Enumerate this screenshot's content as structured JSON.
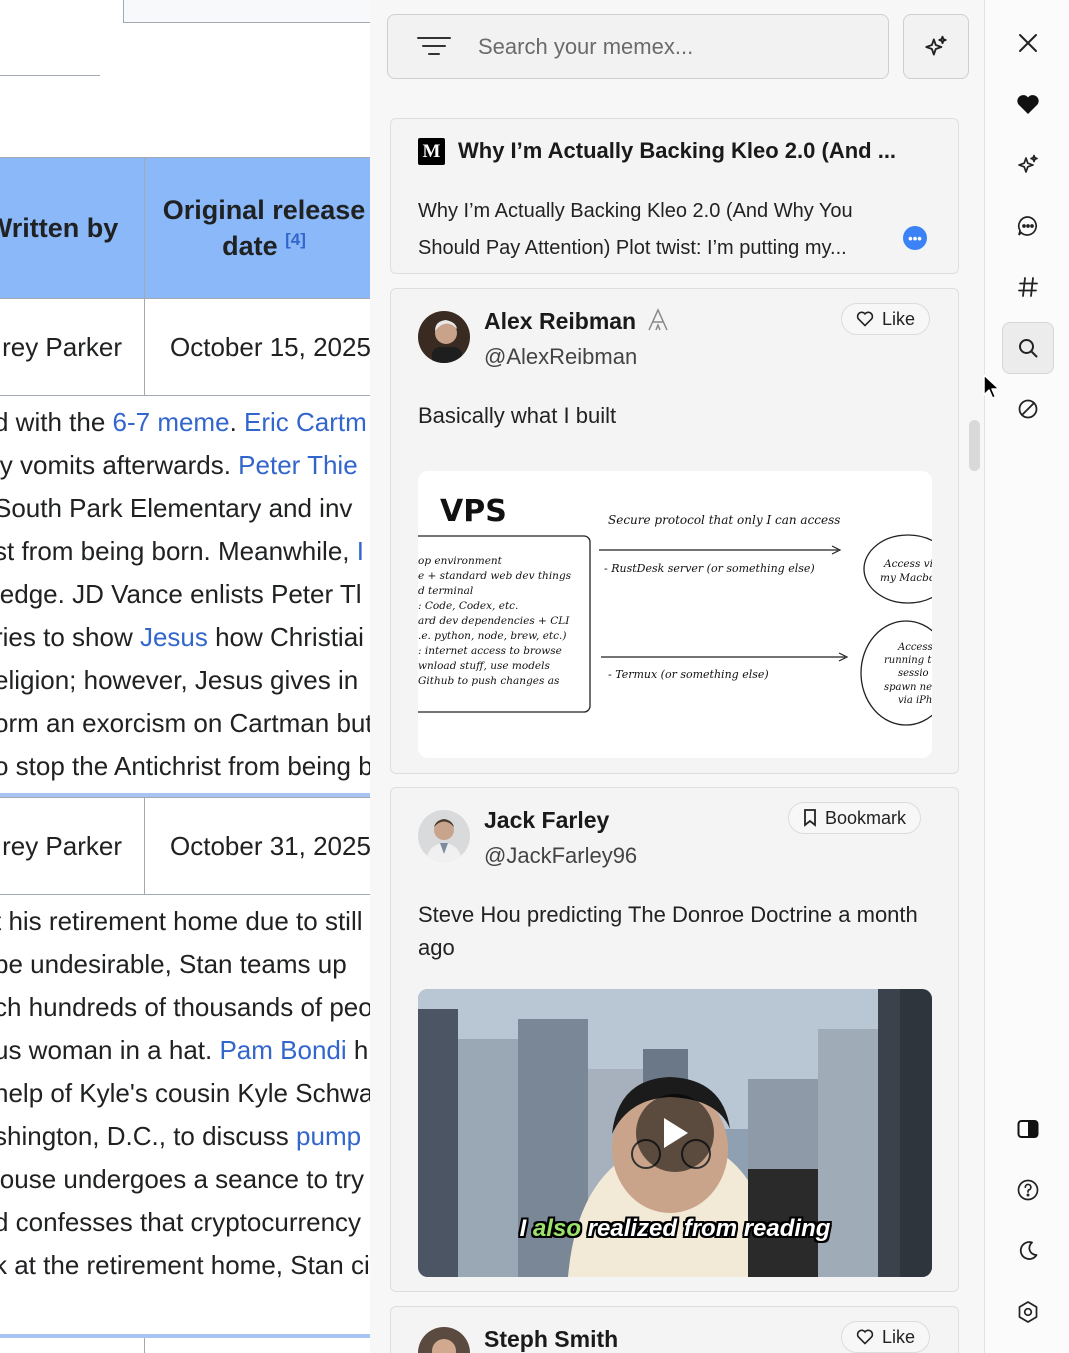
{
  "wiki": {
    "table_headers": [
      "Written by",
      "Original release date"
    ],
    "header_ref": "[4]",
    "rows": [
      {
        "written_by": "rey Parker",
        "release_date": "October 15, 2025"
      },
      {
        "written_by": "rey Parker",
        "release_date": "October 31, 2025"
      }
    ],
    "para1": [
      {
        "pre": "d with the ",
        "link": "6-7 meme",
        "mid": ". ",
        "link2": "Eric Cartm",
        "post": ""
      },
      {
        "pre": "ly vomits afterwards. ",
        "link": "Peter Thie",
        "mid": "",
        "link2": "",
        "post": ""
      },
      {
        "pre": " South Park Elementary and inv",
        "link": "",
        "mid": "",
        "link2": "",
        "post": ""
      },
      {
        "pre": "st from being born. Meanwhile, ",
        "link": "I",
        "mid": "",
        "link2": "",
        "post": ""
      },
      {
        "pre": "ledge. JD Vance enlists Peter Tl",
        "link": "",
        "mid": "",
        "link2": "",
        "post": ""
      },
      {
        "pre": "ries to show ",
        "link": "Jesus",
        "mid": " how Christiai",
        "link2": "",
        "post": ""
      },
      {
        "pre": "eligion; however, Jesus gives in",
        "link": "",
        "mid": "",
        "link2": "",
        "post": ""
      },
      {
        "pre": "orm an exorcism on Cartman but",
        "link": "",
        "mid": "",
        "link2": "",
        "post": ""
      },
      {
        "pre": "o stop the Antichrist from being b",
        "link": "",
        "mid": "",
        "link2": "",
        "post": ""
      }
    ],
    "para2": [
      {
        "pre": "t his retirement home due to still",
        "link": "",
        "mid": ""
      },
      {
        "pre": " be undesirable, Stan teams up",
        "link": "",
        "mid": ""
      },
      {
        "pre": "ch hundreds of thousands of peo",
        "link": "",
        "mid": ""
      },
      {
        "pre": "us woman in a hat. ",
        "link": "Pam Bondi",
        "mid": " h"
      },
      {
        "pre": "help of Kyle's cousin Kyle Schwa",
        "link": "",
        "mid": ""
      },
      {
        "pre": "shington, D.C., to discuss ",
        "link": "pump",
        "mid": ""
      },
      {
        "pre": "louse undergoes a seance to try",
        "link": "",
        "mid": ""
      },
      {
        "pre": "d confesses that cryptocurrency",
        "link": "",
        "mid": ""
      },
      {
        "pre": "k at the retirement home, Stan ci",
        "link": "",
        "mid": ""
      }
    ]
  },
  "search": {
    "placeholder": "Search your memex..."
  },
  "cards": [
    {
      "source_icon": "medium-logo",
      "logo_text": "M",
      "title": "Why I’m Actually Backing Kleo 2.0 (And ...",
      "body": "Why I’m Actually Backing Kleo 2.0 (And Why You Should Pay Attention) Plot twist: I’m putting my..."
    },
    {
      "author": "Alex Reibman",
      "handle": "@AlexReibman",
      "action": "Like",
      "text": "Basically what I built",
      "sketch": {
        "title": "VPS",
        "top_label": "Secure protocol that only I can access",
        "box_lines": [
          "op environment",
          "e + standard web dev things",
          "d terminal",
          ": Code, Codex, etc.",
          "ard dev dependencies + CLI",
          ".e. python, node, brew, etc.)",
          ": internet access to browse",
          "wnload stuff, use models",
          "Github to push changes as"
        ],
        "arrow1_label": "- RustDesk server (or something else)",
        "arrow2_label": "- Termux (or something else)",
        "circle1": [
          "Access vi",
          "my Macbo"
        ],
        "circle2": [
          "Access",
          "running t",
          "sessio",
          "spawn ne",
          "via iPh"
        ]
      }
    },
    {
      "author": "Jack Farley",
      "handle": "@JackFarley96",
      "action": "Bookmark",
      "text": "Steve Hou predicting The Donroe Doctrine a month ago",
      "caption_pre": "I ",
      "caption_hl": "also",
      "caption_post": " realized from reading"
    },
    {
      "author": "Steph Smith",
      "action": "Like"
    }
  ],
  "rail": [
    "close-icon",
    "heart-icon",
    "sparkle-icon",
    "chat-icon",
    "hashtag-icon",
    "search-icon",
    "block-icon",
    "sidebar-toggle-icon",
    "help-icon",
    "moon-icon",
    "settings-icon"
  ]
}
